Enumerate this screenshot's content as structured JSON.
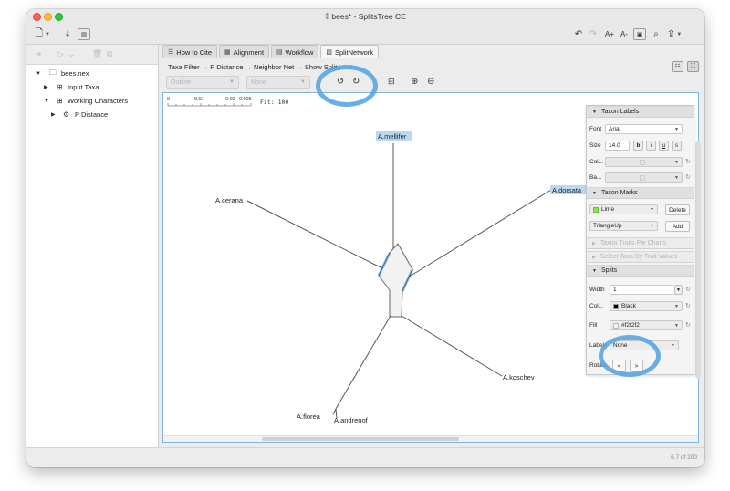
{
  "window": {
    "title": "bees* - SplitsTree CE"
  },
  "toolbar": {
    "new_icon": "🗋",
    "download_icon": "⤓",
    "sidebar_icon": "▥",
    "undo": "↶",
    "redo": "↷",
    "font_up": "A+",
    "font_down": "A-",
    "fit": "▣",
    "search": "⌕",
    "share": "⇪"
  },
  "left_tree": [
    {
      "label": "bees.nex",
      "icon": "folder-icon"
    },
    {
      "label": "Input Taxa",
      "icon": "table-icon"
    },
    {
      "label": "Working Characters",
      "icon": "table-icon"
    },
    {
      "label": "P Distance",
      "icon": "gear-icon"
    }
  ],
  "tabs": [
    {
      "label": "How to Cite",
      "icon": "☰"
    },
    {
      "label": "Alignment",
      "icon": "▦"
    },
    {
      "label": "Workflow",
      "icon": "▤"
    },
    {
      "label": "SplitNetwork",
      "icon": "▧"
    }
  ],
  "breadcrumb": "Taxa Filter → P Distance → Neighbor Net → Show Splits",
  "breadcrumb_tail": "... 1",
  "controls": {
    "layout_combo": "Outline",
    "rooting_combo": "None"
  },
  "scale": {
    "ticks": [
      "0",
      "0.01",
      "0.02",
      "0.025"
    ],
    "fit": "Fit: 100"
  },
  "taxa": [
    "A.mellifer",
    "A.dorsata",
    "A.cerana",
    "A.koschev",
    "A.florea",
    "A.andrenof"
  ],
  "format": {
    "taxon_labels": {
      "header": "Taxon Labels",
      "font_label": "Font",
      "font_value": "Arial",
      "size_label": "Size",
      "size_value": "14.0",
      "bold": "b",
      "italic": "i",
      "underline": "u",
      "strike": "s",
      "color_label": "Col...",
      "background_label": "Ba..."
    },
    "taxon_marks": {
      "header": "Taxon Marks",
      "color_value": "Lime",
      "color_hex": "#8fe05a",
      "shape_value": "TriangleUp",
      "delete_label": "Delete",
      "add_label": "Add"
    },
    "pie_charts": "Taxon Traits Pie Charts",
    "select_by_trait": "Select Taxa By Trait Values",
    "splits": {
      "header": "Splits",
      "width_label": "Width",
      "width_value": "1",
      "color_label": "Col...",
      "color_value": "Black",
      "fill_label": "Fill",
      "fill_value": "#f2f2f2",
      "labels_label": "Labels",
      "labels_value": "None",
      "rotate_label": "Rotate",
      "rotate_left": "<",
      "rotate_right": ">"
    }
  },
  "status": "6.7 of 200"
}
